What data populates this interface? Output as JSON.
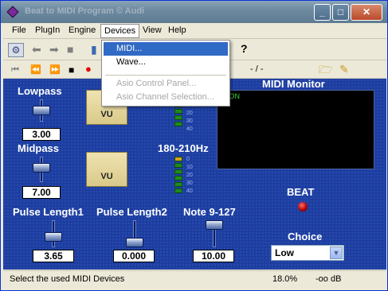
{
  "window": {
    "title": "Beat to MIDI Program © Audi",
    "min": "_",
    "max": "□",
    "close": "✕"
  },
  "menubar": [
    "File",
    "PlugIn",
    "Engine",
    "Devices",
    "View",
    "Help"
  ],
  "devices_menu": {
    "items": [
      {
        "label": "MIDI...",
        "state": "highlighted"
      },
      {
        "label": "Wave...",
        "state": "normal"
      },
      {
        "label": "Asio Control Panel...",
        "state": "disabled"
      },
      {
        "label": "Asio Channel Selection...",
        "state": "disabled"
      }
    ]
  },
  "transport": {
    "time": "- / -"
  },
  "controls": {
    "lowpass": {
      "label": "Lowpass",
      "value": "3.00"
    },
    "midpass": {
      "label": "Midpass",
      "value": "7.00"
    },
    "pulse_length1": {
      "label": "Pulse Length1",
      "value": "3.65"
    },
    "pulse_length2": {
      "label": "Pulse Length2",
      "value": "0.000"
    },
    "note": {
      "label": "Note 9-127",
      "value": "10.00"
    }
  },
  "vu": {
    "label": "VU"
  },
  "range_label": "180-210Hz",
  "meter_scale": [
    "0",
    "10",
    "20",
    "30",
    "40"
  ],
  "midi_monitor": {
    "title": "MIDI Monitor",
    "text": "nd ON"
  },
  "beat": {
    "label": "BEAT"
  },
  "choice": {
    "label": "Choice",
    "value": "Low"
  },
  "status": {
    "text": "Select the used MIDI Devices",
    "zoom": "18.0%",
    "level": "-oo dB"
  },
  "colors": {
    "panel": "#1d3ea0",
    "highlight": "#316ac5",
    "led": "#cc0000"
  }
}
